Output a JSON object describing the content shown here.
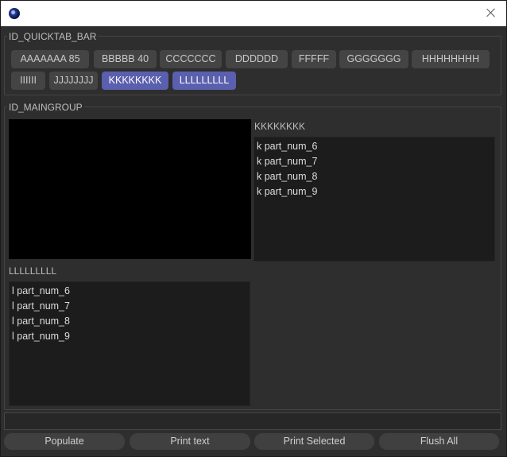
{
  "window": {
    "title": ""
  },
  "quicktab": {
    "group_title": "ID_QUICKTAB_BAR",
    "tabs": [
      {
        "label": "AAAAAAA 85",
        "active": false
      },
      {
        "label": "BBBBB 40",
        "active": false
      },
      {
        "label": "CCCCCCC",
        "active": false
      },
      {
        "label": "DDDDDD",
        "active": false
      },
      {
        "label": "FFFFF",
        "active": false
      },
      {
        "label": "GGGGGGG",
        "active": false
      },
      {
        "label": "HHHHHHHH",
        "active": false
      },
      {
        "label": "IIIIII",
        "active": false
      },
      {
        "label": "JJJJJJJJ",
        "active": false
      },
      {
        "label": "KKKKKKKK",
        "active": true
      },
      {
        "label": "LLLLLLLLL",
        "active": true
      }
    ]
  },
  "main": {
    "group_title": "ID_MAINGROUP",
    "k_list": {
      "label": "KKKKKKKK",
      "items": [
        "k part_num_6",
        "k part_num_7",
        "k part_num_8",
        "k part_num_9"
      ]
    },
    "l_list": {
      "label": "LLLLLLLLL",
      "items": [
        "l part_num_6",
        "l part_num_7",
        "l part_num_8",
        "l part_num_9"
      ]
    }
  },
  "status": {
    "text": ""
  },
  "buttons": {
    "populate": "Populate",
    "print_text": "Print text",
    "print_selected": "Print Selected",
    "flush_all": "Flush All"
  },
  "colors": {
    "active_tab": "#5a5fae",
    "tab": "#444444",
    "background": "#2e2e2e"
  }
}
